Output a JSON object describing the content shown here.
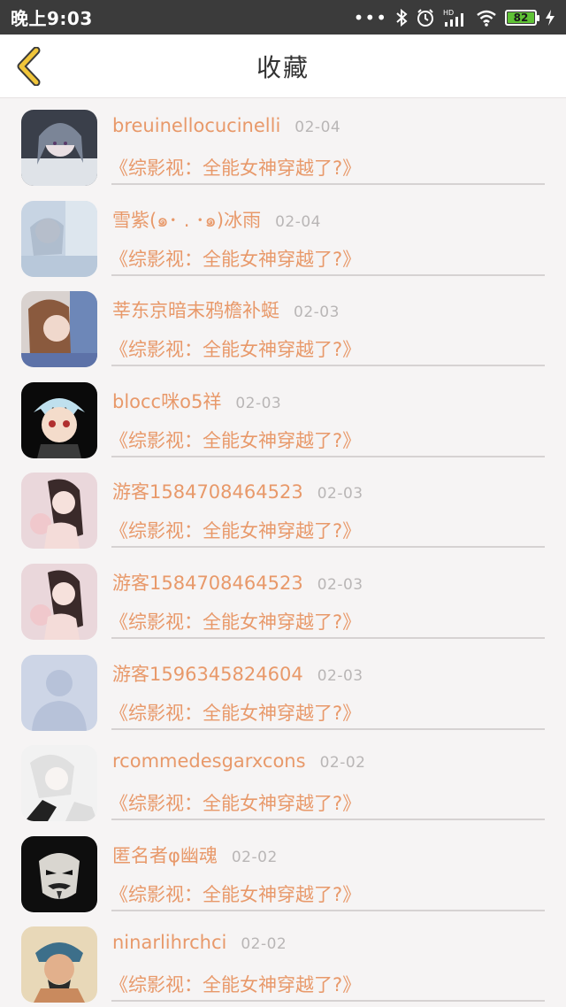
{
  "status_bar": {
    "time": "晚上9:03",
    "battery": "82",
    "icons": [
      "more-dots-icon",
      "bluetooth-icon",
      "alarm-icon",
      "signal-hd-icon",
      "wifi-icon",
      "battery-icon",
      "charging-icon"
    ]
  },
  "header": {
    "title": "收藏",
    "back_icon": "chevron-left-icon"
  },
  "colors": {
    "accent": "#e8996a",
    "back_icon": "#f0c53a",
    "date": "#b9b6b6",
    "background": "#f6f4f4"
  },
  "items": [
    {
      "name": "breuinellocucinelli",
      "date": "02-04",
      "book": "《综影视：全能女神穿越了?》"
    },
    {
      "name": "雪紫(๑･ . ･๑)冰雨",
      "date": "02-04",
      "book": "《综影视：全能女神穿越了?》"
    },
    {
      "name": "莘东京暗末鸦檐补蜓",
      "date": "02-03",
      "book": "《综影视：全能女神穿越了?》"
    },
    {
      "name": "blocc咪o5祥",
      "date": "02-03",
      "book": "《综影视：全能女神穿越了?》"
    },
    {
      "name": "游客1584708464523",
      "date": "02-03",
      "book": "《综影视：全能女神穿越了?》"
    },
    {
      "name": "游客1584708464523",
      "date": "02-03",
      "book": "《综影视：全能女神穿越了?》"
    },
    {
      "name": "游客1596345824604",
      "date": "02-03",
      "book": "《综影视：全能女神穿越了?》"
    },
    {
      "name": "rcommedesgarxcons",
      "date": "02-02",
      "book": "《综影视：全能女神穿越了?》"
    },
    {
      "name": "匿名者φ幽魂",
      "date": "02-02",
      "book": "《综影视：全能女神穿越了?》"
    },
    {
      "name": "ninarlihrchci",
      "date": "02-02",
      "book": "《综影视：全能女神穿越了?》"
    }
  ]
}
